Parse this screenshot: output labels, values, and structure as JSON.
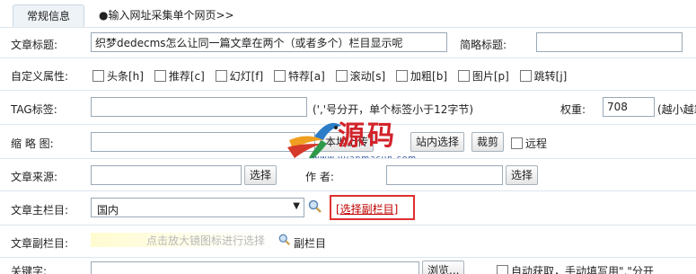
{
  "tabs": {
    "general": "常规信息",
    "collect": "●输入网址采集单个网页>>"
  },
  "title_row": {
    "label": "文章标题:",
    "value": "织梦dedecms怎么让同一篇文章在两个（或者多个）栏目显示呢",
    "short_label": "简略标题:",
    "short_value": ""
  },
  "attr_row": {
    "label": "自定义属性:",
    "options": [
      "头条[h]",
      "推荐[c]",
      "幻灯[f]",
      "特荐[a]",
      "滚动[s]",
      "加粗[b]",
      "图片[p]",
      "跳转[j]"
    ]
  },
  "tag_row": {
    "label": "TAG标签:",
    "hint": "(','号分开，单个标签小于12字节)",
    "weight_label": "权重:",
    "weight_value": "708",
    "weight_hint": "(越小越靠前)"
  },
  "thumb_row": {
    "label": "缩 略 图:",
    "upload": "本地上传",
    "site_select": "站内选择",
    "crop": "裁剪",
    "remote": "远程"
  },
  "source_row": {
    "label": "文章来源:",
    "select": "选择",
    "author_label": "作 者:",
    "author_select": "选择"
  },
  "main_col_row": {
    "label": "文章主栏目:",
    "value": "国内",
    "sub_link": "[选择副栏目]"
  },
  "sub_col_row": {
    "label": "文章副栏目:",
    "placeholder": "点击放大镜图标进行选择",
    "icon_label": "副栏目"
  },
  "keywords_row": {
    "label": "关键字:",
    "browse": "浏览...",
    "auto_text": "自动获取，手动填写用\",\"分开"
  },
  "watermark": {
    "text": "源码村",
    "url": "www.yuanmacun.com"
  },
  "colors": {
    "highlight_box": "#e03030",
    "link_red": "#c00000"
  }
}
